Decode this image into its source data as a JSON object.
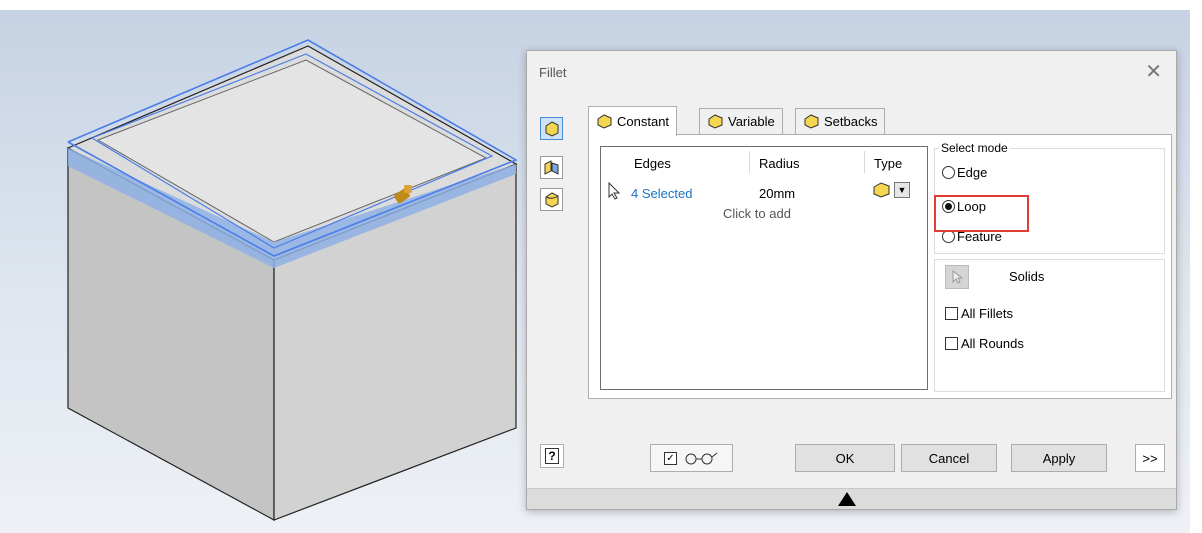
{
  "dialog": {
    "title": "Fillet",
    "close_icon": "close-icon",
    "tabs": [
      {
        "label": "Constant",
        "icon": "constant-fillet-icon",
        "active": true
      },
      {
        "label": "Variable",
        "icon": "variable-fillet-icon",
        "active": false
      },
      {
        "label": "Setbacks",
        "icon": "setback-fillet-icon",
        "active": false
      }
    ],
    "edge_table": {
      "columns": [
        "Edges",
        "Radius",
        "Type"
      ],
      "rows": [
        {
          "edges": "4 Selected",
          "radius": "20mm",
          "type_icon": "fillet-type-icon"
        }
      ],
      "add_hint": "Click to add"
    },
    "select_mode": {
      "legend": "Select mode",
      "options": [
        "Edge",
        "Loop",
        "Feature"
      ],
      "selected": "Loop"
    },
    "solids": {
      "label": "Solids",
      "checkboxes": [
        {
          "label": "All Fillets",
          "checked": false
        },
        {
          "label": "All Rounds",
          "checked": false
        }
      ]
    },
    "buttons": {
      "ok": "OK",
      "cancel": "Cancel",
      "apply": "Apply",
      "expand": ">>"
    },
    "preview_checked": true
  },
  "colors": {
    "selection_blue": "#4a7de8",
    "highlight_red": "#e03c31",
    "link_blue": "#1a73c8",
    "viewport_top": "#c6d2e3"
  }
}
